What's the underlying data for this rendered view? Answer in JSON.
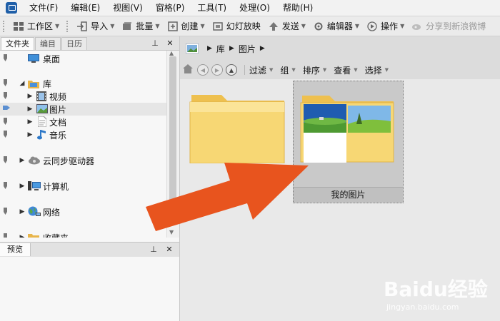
{
  "menubar": {
    "items": [
      "文件(F)",
      "编辑(E)",
      "视图(V)",
      "窗格(P)",
      "工具(T)",
      "处理(O)",
      "帮助(H)"
    ]
  },
  "toolbar": {
    "buttons": [
      {
        "label": "工作区",
        "icon": "workspace-icon"
      },
      {
        "label": "导入",
        "icon": "import-icon"
      },
      {
        "label": "批量",
        "icon": "batch-icon"
      },
      {
        "label": "创建",
        "icon": "create-icon"
      },
      {
        "label": "幻灯放映",
        "icon": "slideshow-icon"
      },
      {
        "label": "发送",
        "icon": "send-icon"
      },
      {
        "label": "编辑器",
        "icon": "editor-icon"
      },
      {
        "label": "操作",
        "icon": "play-icon"
      },
      {
        "label": "分享到新浪微博",
        "icon": "weibo-icon"
      }
    ]
  },
  "left_panel": {
    "tabs": [
      "文件夹",
      "编目",
      "日历"
    ],
    "pin_glyph": "⊥",
    "close_glyph": "✕",
    "tree": [
      {
        "label": "桌面"
      },
      {
        "label": "库"
      },
      {
        "label": "视频"
      },
      {
        "label": "图片"
      },
      {
        "label": "文档"
      },
      {
        "label": "音乐"
      },
      {
        "label": "云同步驱动器"
      },
      {
        "label": "计算机"
      },
      {
        "label": "网络"
      },
      {
        "label": "收藏夹"
      }
    ],
    "preview_label": "预览"
  },
  "address_bar": {
    "crumbs": [
      "库",
      "图片"
    ]
  },
  "nav_toolbar": {
    "buttons": [
      "过滤",
      "组",
      "排序",
      "查看",
      "选择"
    ]
  },
  "content": {
    "folder_b_label": "我的图片"
  },
  "watermark": {
    "brand": "Baidu经验",
    "url": "jingyan.baidu.com"
  },
  "colors": {
    "arrow": "#e8541e",
    "folder_front": "#f7d774",
    "folder_back": "#eec04f"
  }
}
